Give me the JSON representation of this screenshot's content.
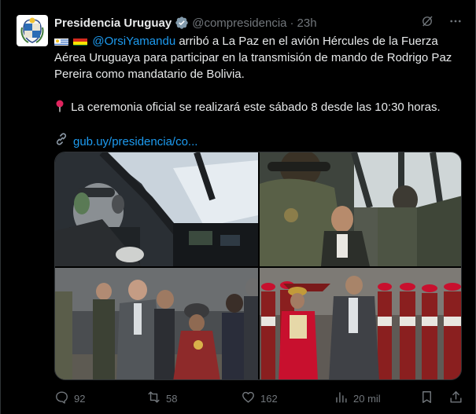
{
  "account": {
    "name": "Presidencia Uruguay",
    "handle": "@compresidencia",
    "separator": "·",
    "time": "23h",
    "avatar_icon": "uruguay-coat-of-arms"
  },
  "post": {
    "flags": [
      "uruguay-flag",
      "bolivia-flag"
    ],
    "mention": "@OrsiYamandu",
    "line1_rest": " arribó a La Paz en el avión Hércules de la Fuerza",
    "line2": "Aérea Uruguaya para participar en la transmisión de mando de Rodrigo Paz",
    "line3": "Pereira como mandatario de Bolivia.",
    "pin_icon": "round-pushpin",
    "para2": "La ceremonia oficial se realizará este sábado 8 desde las 10:30 horas.",
    "link_icon": "link-icon",
    "link_text": "gub.uy/presidencia/co..."
  },
  "media": [
    {
      "subject": "cockpit-headset-passenger"
    },
    {
      "subject": "cockpit-crew-seated"
    },
    {
      "subject": "tarmac-welcome-handshake"
    },
    {
      "subject": "honor-guard-review"
    }
  ],
  "metrics": {
    "replies": "92",
    "reposts": "58",
    "likes": "162",
    "views": "20 mil"
  },
  "colors": {
    "background": "#000000",
    "text": "#e7e9ea",
    "muted": "#71767b",
    "link": "#1d9bf0",
    "verified": "#829aab"
  }
}
